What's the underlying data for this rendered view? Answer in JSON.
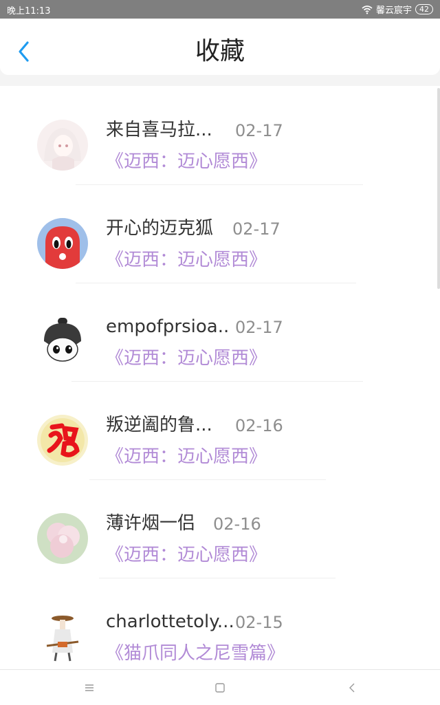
{
  "status_bar": {
    "time": "晚上11:13",
    "carrier": "馨云宸宇",
    "battery": "42"
  },
  "header": {
    "title": "收藏"
  },
  "favorites": [
    {
      "user": "来自喜马拉...",
      "date": "02-17",
      "title": "《迈西：迈心愿西》"
    },
    {
      "user": "开心的迈克狐",
      "date": "02-17",
      "title": "《迈西：迈心愿西》"
    },
    {
      "user": "empofprsioa..",
      "date": "02-17",
      "title": "《迈西：迈心愿西》"
    },
    {
      "user": "叛逆阖的鲁...",
      "date": "02-16",
      "title": "《迈西：迈心愿西》"
    },
    {
      "user": "薄许烟一侣",
      "date": "02-16",
      "title": "《迈西：迈心愿西》"
    },
    {
      "user": "charlottetoly...",
      "date": "02-15",
      "title": "《猫爪同人之尼雪篇》"
    }
  ],
  "colors": {
    "accent": "#1e9bf0",
    "title_purple": "#b18ad6",
    "date_gray": "#8e8e8e"
  }
}
